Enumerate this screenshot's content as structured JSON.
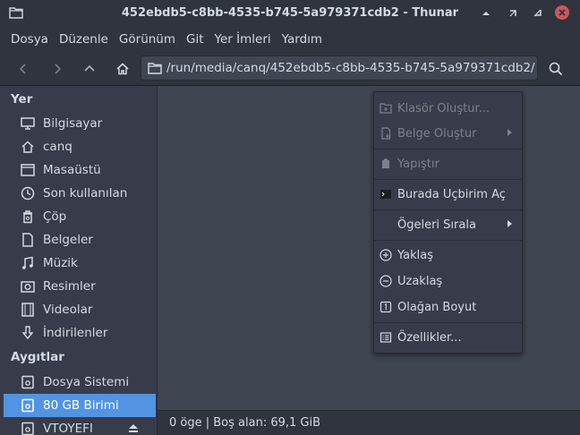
{
  "window": {
    "title": "452ebdb5-c8bb-4535-b745-5a979371cdb2 - Thunar",
    "close_color": "#cc575d",
    "accent": "#5294e2"
  },
  "menubar": {
    "items": [
      "Dosya",
      "Düzenle",
      "Görünüm",
      "Git",
      "Yer İmleri",
      "Yardım"
    ]
  },
  "toolbar": {
    "path": "/run/media/canq/452ebdb5-c8bb-4535-b745-5a979371cdb2/"
  },
  "sidebar": {
    "places_header": "Yer",
    "places": [
      {
        "label": "Bilgisayar",
        "icon": "computer-icon"
      },
      {
        "label": "canq",
        "icon": "home-folder-icon"
      },
      {
        "label": "Masaüstü",
        "icon": "desktop-icon"
      },
      {
        "label": "Son kullanılan",
        "icon": "recent-icon"
      },
      {
        "label": "Çöp",
        "icon": "trash-icon"
      },
      {
        "label": "Belgeler",
        "icon": "documents-icon"
      },
      {
        "label": "Müzik",
        "icon": "music-icon"
      },
      {
        "label": "Resimler",
        "icon": "pictures-icon"
      },
      {
        "label": "Videolar",
        "icon": "videos-icon"
      },
      {
        "label": "İndirilenler",
        "icon": "downloads-icon"
      }
    ],
    "devices_header": "Aygıtlar",
    "devices": [
      {
        "label": "Dosya Sistemi",
        "icon": "drive-icon"
      },
      {
        "label": "80 GB Birimi",
        "icon": "drive-icon",
        "selected": true
      },
      {
        "label": "VTOYEFI",
        "icon": "drive-icon",
        "eject": true
      }
    ]
  },
  "statusbar": {
    "text": "0 öge  |  Boş alan: 69,1 GiB"
  },
  "context_menu": {
    "items": [
      {
        "label": "Klasör Oluştur...",
        "icon": "new-folder-icon",
        "disabled": true,
        "submenu": false
      },
      {
        "label": "Belge Oluştur",
        "icon": "new-document-icon",
        "disabled": true,
        "submenu": true
      },
      {
        "label": "Yapıştır",
        "icon": "paste-icon",
        "disabled": true,
        "submenu": false
      },
      {
        "label": "Burada Uçbirim Aç",
        "icon": "terminal-icon",
        "disabled": false,
        "submenu": false
      },
      {
        "label": "Ögeleri Sırala",
        "icon": "",
        "disabled": false,
        "submenu": true
      },
      {
        "label": "Yaklaş",
        "icon": "zoom-in-icon",
        "disabled": false,
        "submenu": false
      },
      {
        "label": "Uzaklaş",
        "icon": "zoom-out-icon",
        "disabled": false,
        "submenu": false
      },
      {
        "label": "Olağan Boyut",
        "icon": "zoom-original-icon",
        "disabled": false,
        "submenu": false
      },
      {
        "label": "Özellikler...",
        "icon": "properties-icon",
        "disabled": false,
        "submenu": false
      }
    ]
  }
}
